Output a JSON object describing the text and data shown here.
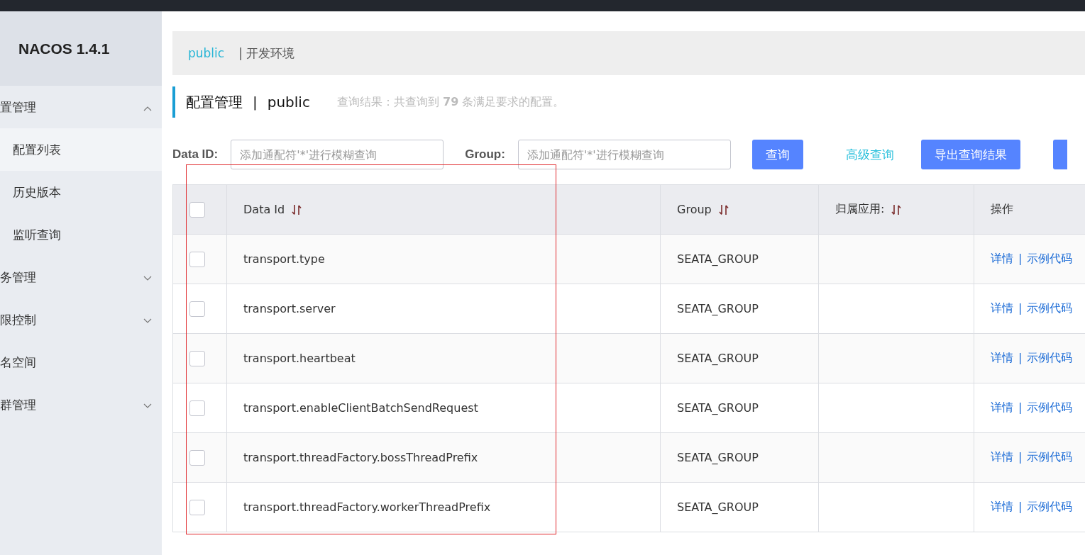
{
  "logo": "NACOS 1.4.1",
  "sidebar": {
    "items": [
      {
        "label": "置管理",
        "expanded": true,
        "children": [
          {
            "label": "配置列表",
            "selected": true
          },
          {
            "label": "历史版本",
            "selected": false
          },
          {
            "label": "监听查询",
            "selected": false
          }
        ]
      },
      {
        "label": "务管理",
        "expanded": false
      },
      {
        "label": "限控制",
        "expanded": false
      },
      {
        "label": "名空间"
      },
      {
        "label": "群管理",
        "expanded": false
      }
    ]
  },
  "namespaces": [
    {
      "label": "public",
      "selected": true
    },
    {
      "separator": "|",
      "label": "开发环境",
      "selected": false
    }
  ],
  "page_title": {
    "title": "配置管理",
    "separator": "|",
    "namespace": "public",
    "summary": "查询结果：共查询到 **79** 条满足要求的配置。"
  },
  "search": {
    "data_id_label": "Data ID:",
    "data_id_placeholder": "添加通配符'*'进行模糊查询",
    "group_label": "Group:",
    "group_placeholder": "添加通配符'*'进行模糊查询",
    "query_button": "查询",
    "advanced_link": "高级查询",
    "export_button": "导出查询结果"
  },
  "table": {
    "select_all_checked": false,
    "columns": [
      {
        "label": "Data Id",
        "sortable": true
      },
      {
        "label": "Group",
        "sortable": true
      },
      {
        "label": "归属应用:",
        "sortable": true
      },
      {
        "label": "操作",
        "sortable": false
      }
    ],
    "rows": [
      {
        "checked": false,
        "data_id": "transport.type",
        "group": "SEATA_GROUP",
        "actions": [
          "详情",
          "示例代码"
        ],
        "action_separator": "|"
      },
      {
        "checked": false,
        "data_id": "transport.server",
        "group": "SEATA_GROUP",
        "actions": [
          "详情",
          "示例代码"
        ],
        "action_separator": "|"
      },
      {
        "checked": false,
        "data_id": "transport.heartbeat",
        "group": "SEATA_GROUP",
        "actions": [
          "详情",
          "示例代码"
        ],
        "action_separator": "|"
      },
      {
        "checked": false,
        "data_id": "transport.enableClientBatchSendRequest",
        "group": "SEATA_GROUP",
        "actions": [
          "详情",
          "示例代码"
        ],
        "action_separator": "|"
      },
      {
        "checked": false,
        "data_id": "transport.threadFactory.bossThreadPrefix",
        "group": "SEATA_GROUP",
        "actions": [
          "详情",
          "示例代码"
        ],
        "action_separator": "|"
      },
      {
        "checked": false,
        "data_id": "transport.threadFactory.workerThreadPrefix",
        "group": "SEATA_GROUP",
        "actions": [
          "详情",
          "示例代码"
        ],
        "action_separator": "|"
      }
    ]
  }
}
